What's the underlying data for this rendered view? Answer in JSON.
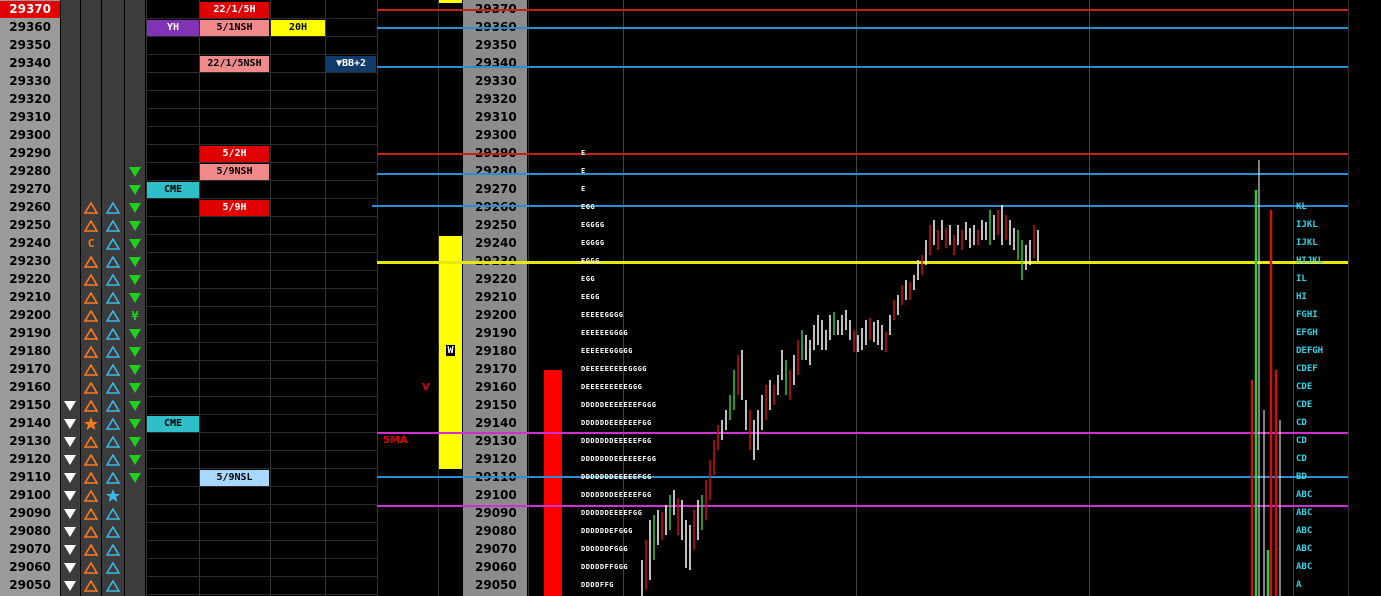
{
  "prices": [
    "29370",
    "29360",
    "29350",
    "29340",
    "29330",
    "29320",
    "29310",
    "29300",
    "29290",
    "29280",
    "29270",
    "29260",
    "29250",
    "29240",
    "29230",
    "29220",
    "29210",
    "29200",
    "29190",
    "29180",
    "29170",
    "29160",
    "29150",
    "29140",
    "29130",
    "29120",
    "29110",
    "29100",
    "29090",
    "29080",
    "29070",
    "29060",
    "29050"
  ],
  "highlighted_price": "29370",
  "level_tags": [
    {
      "row": 0,
      "col": "b",
      "text": "22/1/5H",
      "bg": "#e00000",
      "fg": "#ffffff"
    },
    {
      "row": 1,
      "col": "a",
      "text": "YH",
      "bg": "#7f33b5",
      "fg": "#ffffff"
    },
    {
      "row": 1,
      "col": "b",
      "text": "5/1NSH",
      "bg": "#f08a8a",
      "fg": "#000000"
    },
    {
      "row": 1,
      "col": "c",
      "text": "20H",
      "bg": "#ffff00",
      "fg": "#000000"
    },
    {
      "row": 3,
      "col": "b",
      "text": "22/1/5NSH",
      "bg": "#f08a8a",
      "fg": "#000000"
    },
    {
      "row": 3,
      "col": "d",
      "text": "▼BB+2",
      "bg": "#103a6a",
      "fg": "#ffffff"
    },
    {
      "row": 8,
      "col": "b",
      "text": "5/2H",
      "bg": "#e00000",
      "fg": "#ffffff"
    },
    {
      "row": 9,
      "col": "b",
      "text": "5/9NSH",
      "bg": "#f08a8a",
      "fg": "#000000"
    },
    {
      "row": 10,
      "col": "a",
      "text": "CME",
      "bg": "#2fbfc8",
      "fg": "#000000"
    },
    {
      "row": 11,
      "col": "b",
      "text": "5/9H",
      "bg": "#e00000",
      "fg": "#ffffff"
    },
    {
      "row": 23,
      "col": "a",
      "text": "CME",
      "bg": "#2fbfc8",
      "fg": "#000000"
    },
    {
      "row": 26,
      "col": "b",
      "text": "5/9NSL",
      "bg": "#a8d8ff",
      "fg": "#000000"
    }
  ],
  "signals": {
    "col1_white_down_rows": [
      22,
      23,
      24,
      25,
      26,
      27,
      28,
      29,
      30,
      31,
      32
    ],
    "col2_orange_up_rows": [
      11,
      12,
      14,
      15,
      16,
      17,
      18,
      19,
      20,
      21,
      22,
      24,
      25,
      26,
      27,
      28,
      29,
      30,
      31,
      32
    ],
    "col2_c_row": 13,
    "col2_c_text": "C",
    "col2_star_row": 23,
    "col3_blue_up_rows": [
      11,
      12,
      13,
      14,
      15,
      16,
      17,
      18,
      19,
      20,
      21,
      22,
      23,
      24,
      25,
      26,
      28,
      29,
      30,
      31,
      32
    ],
    "col3_star_row": 27,
    "col4_green_down_rows": [
      9,
      10,
      11,
      12,
      13,
      14,
      15,
      16,
      18,
      19,
      20,
      21,
      22,
      23,
      24,
      25,
      26
    ],
    "col4_yen_row": 17,
    "col4_yen_text": "¥"
  },
  "annotations": {
    "v_mark": "V",
    "ma_label": "5MA",
    "w_mark": "W"
  },
  "tpo_profile": [
    {
      "row": 8,
      "text": "E"
    },
    {
      "row": 9,
      "text": "E"
    },
    {
      "row": 10,
      "text": "E"
    },
    {
      "row": 11,
      "text": "EGG"
    },
    {
      "row": 12,
      "text": "EGGGG"
    },
    {
      "row": 13,
      "text": "EGGGG"
    },
    {
      "row": 14,
      "text": "EGGG"
    },
    {
      "row": 15,
      "text": "EGG"
    },
    {
      "row": 16,
      "text": "EEGG"
    },
    {
      "row": 17,
      "text": "EEEEEGGGG"
    },
    {
      "row": 18,
      "text": "EEEEEEGGGG"
    },
    {
      "row": 19,
      "text": "EEEEEEGGGGG"
    },
    {
      "row": 20,
      "text": "DEEEEEEEEEGGGG"
    },
    {
      "row": 21,
      "text": "DEEEEEEEEEGGG"
    },
    {
      "row": 22,
      "text": "DDDDDEEEEEEEFGGG"
    },
    {
      "row": 23,
      "text": "DDDDDDEEEEEEFGG"
    },
    {
      "row": 24,
      "text": "DDDDDDDEEEEEFGG"
    },
    {
      "row": 25,
      "text": "DDDDDDDEEEEEEFGG"
    },
    {
      "row": 26,
      "text": "DDDDDDDEEEEEFGG"
    },
    {
      "row": 27,
      "text": "DDDDDDDEEEEEFGG"
    },
    {
      "row": 28,
      "text": "DDDDDDEEEEFGG"
    },
    {
      "row": 29,
      "text": "DDDDDDEFGGG"
    },
    {
      "row": 30,
      "text": "DDDDDDFGGG"
    },
    {
      "row": 31,
      "text": "DDDDDFFGGG"
    },
    {
      "row": 32,
      "text": "DDDDFFG"
    }
  ],
  "periods": [
    {
      "row": 11,
      "text": "KL"
    },
    {
      "row": 12,
      "text": "IJKL"
    },
    {
      "row": 13,
      "text": "IJKL"
    },
    {
      "row": 14,
      "text": "HIJKL"
    },
    {
      "row": 15,
      "text": "IL"
    },
    {
      "row": 16,
      "text": "HI"
    },
    {
      "row": 17,
      "text": "FGHI"
    },
    {
      "row": 18,
      "text": "EFGH"
    },
    {
      "row": 19,
      "text": "DEFGH"
    },
    {
      "row": 20,
      "text": "CDEF"
    },
    {
      "row": 21,
      "text": "CDE"
    },
    {
      "row": 22,
      "text": "CDE"
    },
    {
      "row": 23,
      "text": "CD"
    },
    {
      "row": 24,
      "text": "CD"
    },
    {
      "row": 25,
      "text": "CD"
    },
    {
      "row": 26,
      "text": "BD"
    },
    {
      "row": 27,
      "text": "ABC"
    },
    {
      "row": 28,
      "text": "ABC"
    },
    {
      "row": 29,
      "text": "ABC"
    },
    {
      "row": 30,
      "text": "ABC"
    },
    {
      "row": 31,
      "text": "ABC"
    },
    {
      "row": 32,
      "text": "A"
    }
  ],
  "colors": {
    "red_line": "#c81e1e",
    "blue_line": "#2a8ed0",
    "magenta_line": "#d030d0",
    "yellow_line": "#e8e800",
    "up_candle": "#2ecc40",
    "down_candle": "#d01010",
    "neutral_candle": "#ffffff"
  }
}
